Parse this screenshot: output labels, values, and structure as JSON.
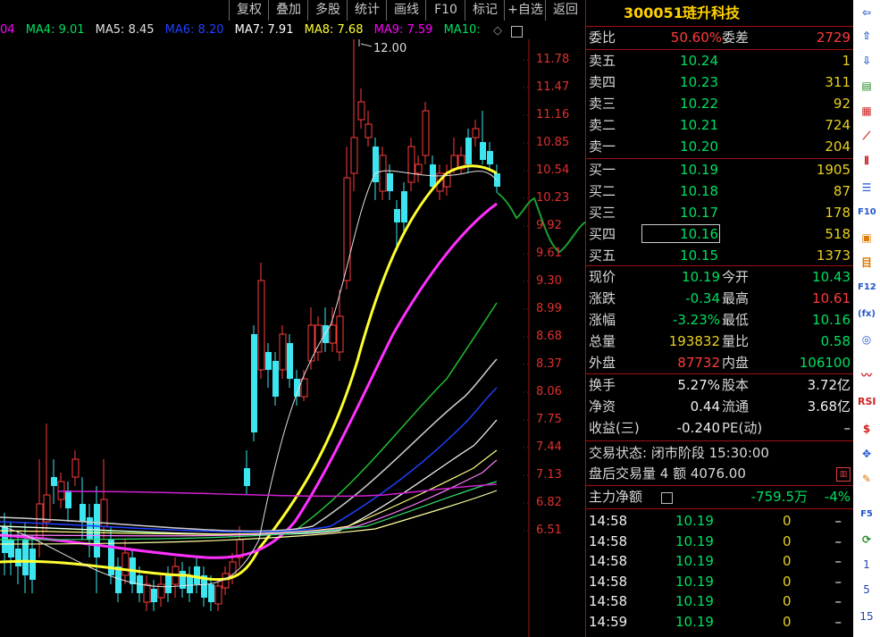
{
  "toolbar": {
    "buttons": [
      "复权",
      "叠加",
      "多股",
      "统计",
      "画线",
      "F10",
      "标记",
      "+自选",
      "返回"
    ]
  },
  "ma": [
    {
      "label": "04",
      "color": "#ff00ff"
    },
    {
      "label": "MA4: 9.01",
      "color": "#00e060"
    },
    {
      "label": "MA5: 8.45",
      "color": "#e0e0e0"
    },
    {
      "label": "MA6: 8.20",
      "color": "#2040ff"
    },
    {
      "label": "MA7: 7.91",
      "color": "#ffffff"
    },
    {
      "label": "MA8: 7.68",
      "color": "#ffff30"
    },
    {
      "label": "MA9: 7.59",
      "color": "#ff00ff"
    },
    {
      "label": "MA10:",
      "color": "#00e060"
    }
  ],
  "chart": {
    "high_label": "12.00",
    "y_ticks": [
      "11.78",
      "11.47",
      "11.16",
      "10.85",
      "10.54",
      "10.23",
      "9.92",
      "9.61",
      "9.30",
      "8.99",
      "8.68",
      "8.37",
      "8.06",
      "7.75",
      "7.44",
      "7.13",
      "6.82",
      "6.51"
    ]
  },
  "stock": {
    "code": "300051",
    "name": "琏升科技"
  },
  "weibi": {
    "l1": "委比",
    "v1": "50.60%",
    "l2": "委差",
    "v2": "2729"
  },
  "sells": [
    {
      "label": "卖五",
      "price": "10.24",
      "vol": "1"
    },
    {
      "label": "卖四",
      "price": "10.23",
      "vol": "311"
    },
    {
      "label": "卖三",
      "price": "10.22",
      "vol": "92"
    },
    {
      "label": "卖二",
      "price": "10.21",
      "vol": "724"
    },
    {
      "label": "卖一",
      "price": "10.20",
      "vol": "204"
    }
  ],
  "buys": [
    {
      "label": "买一",
      "price": "10.19",
      "vol": "1905"
    },
    {
      "label": "买二",
      "price": "10.18",
      "vol": "87"
    },
    {
      "label": "买三",
      "price": "10.17",
      "vol": "178"
    },
    {
      "label": "买四",
      "price": "10.16",
      "vol": "518"
    },
    {
      "label": "买五",
      "price": "10.15",
      "vol": "1373"
    }
  ],
  "quote": [
    {
      "l1": "现价",
      "v1": "10.19",
      "c1": "green",
      "l2": "今开",
      "v2": "10.43",
      "c2": "green"
    },
    {
      "l1": "涨跌",
      "v1": "-0.34",
      "c1": "green",
      "l2": "最高",
      "v2": "10.61",
      "c2": "red"
    },
    {
      "l1": "涨幅",
      "v1": "-3.23%",
      "c1": "green",
      "l2": "最低",
      "v2": "10.16",
      "c2": "green"
    },
    {
      "l1": "总量",
      "v1": "193832",
      "c1": "yellow",
      "l2": "量比",
      "v2": "0.58",
      "c2": "green"
    },
    {
      "l1": "外盘",
      "v1": "87732",
      "c1": "red",
      "l2": "内盘",
      "v2": "106100",
      "c2": "green"
    }
  ],
  "fund": [
    {
      "l1": "换手",
      "v1": "5.27%",
      "l2": "股本",
      "v2": "3.72亿"
    },
    {
      "l1": "净资",
      "v1": "0.44",
      "l2": "流通",
      "v2": "3.68亿"
    },
    {
      "l1": "收益(三)",
      "v1": "-0.240",
      "l2": "PE(动)",
      "v2": "–"
    }
  ],
  "trade_state": {
    "text": "交易状态: 闭市阶段 15:30:00"
  },
  "after_hours": {
    "text": "盘后交易量 4 额 4076.00"
  },
  "main_flow": {
    "label": "主力净额",
    "value": "-759.5万",
    "pct": "-4%"
  },
  "ticks": [
    {
      "time": "14:58",
      "price": "10.19",
      "vol": "0",
      "dir": "–"
    },
    {
      "time": "14:58",
      "price": "10.19",
      "vol": "0",
      "dir": "–"
    },
    {
      "time": "14:58",
      "price": "10.19",
      "vol": "0",
      "dir": "–"
    },
    {
      "time": "14:58",
      "price": "10.19",
      "vol": "0",
      "dir": "–"
    },
    {
      "time": "14:58",
      "price": "10.19",
      "vol": "0",
      "dir": "–"
    },
    {
      "time": "14:59",
      "price": "10.19",
      "vol": "0",
      "dir": "–"
    }
  ],
  "iconbar": {
    "labels": [
      "RSI",
      "1",
      "5",
      "15"
    ]
  }
}
